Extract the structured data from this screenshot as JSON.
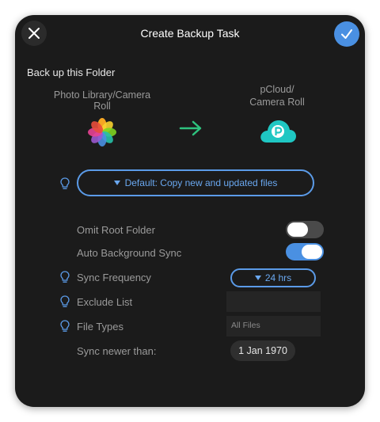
{
  "header": {
    "title": "Create Backup Task"
  },
  "backup": {
    "section_label": "Back up this Folder",
    "source_label": "Photo Library/Camera Roll",
    "dest_label_line1": "pCloud/",
    "dest_label_line2": "Camera Roll",
    "mode": "Default: Copy new and updated files"
  },
  "settings": {
    "omit_root_label": "Omit Root Folder",
    "omit_root_enabled": false,
    "auto_sync_label": "Auto Background Sync",
    "auto_sync_enabled": true,
    "sync_frequency_label": "Sync Frequency",
    "sync_frequency_value": "24 hrs",
    "exclude_list_label": "Exclude List",
    "exclude_list_value": "",
    "file_types_label": "File Types",
    "file_types_value": "All Files",
    "sync_newer_label": "Sync newer than:",
    "sync_newer_value": "1 Jan 1970"
  },
  "colors": {
    "panel_bg": "#1b1b1b",
    "accent_blue": "#4a90e2",
    "arrow_green": "#2ec27e",
    "pcloud_teal": "#1fc7c3"
  },
  "icons": [
    "close-icon",
    "checkmark-icon",
    "photos-icon",
    "arrow-right-icon",
    "pcloud-icon",
    "lightbulb-icon",
    "triangle-down-icon"
  ]
}
